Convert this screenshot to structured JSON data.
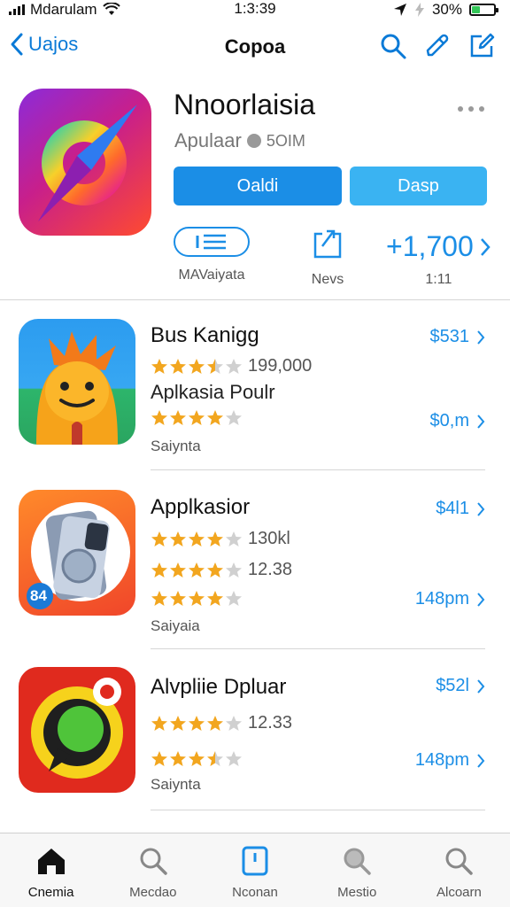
{
  "status": {
    "carrier": "Mdarulam",
    "time": "1:3:39",
    "battery": "30%"
  },
  "nav": {
    "back_label": "Uajos",
    "title": "Copoa"
  },
  "hero": {
    "name": "Nnoorlaisia",
    "subtitle": "Apulaar",
    "size": "5OIM",
    "primary_button": "Oaldi",
    "secondary_button": "Dasp",
    "stat1_label": "MAVaiyata",
    "stat2_label": "Nevs",
    "stat3_value": "+1,700",
    "stat3_label": "1:11"
  },
  "apps": [
    {
      "title": "Bus Kanigg",
      "price": "$531",
      "rating_count": "199,000",
      "subtitle": "Aplkasia Poulr",
      "price2": "$0,m",
      "category": "Saiynta"
    },
    {
      "title": "Applkasior",
      "price": "$4l1",
      "rating_count": "130kl",
      "rating_count2": "12.38",
      "price2": "148pm",
      "category": "Saiyaia",
      "badge": "84"
    },
    {
      "title": "Alvpliie Dpluar",
      "price": "$52l",
      "rating_count": "12.33",
      "price2": "148pm",
      "category": "Saiynta"
    }
  ],
  "tabs": [
    "Cnemia",
    "Mecdao",
    "Nconan",
    "Mestio",
    "Alcoarn"
  ],
  "icons": {
    "back": "chevron-left-icon",
    "search": "search-icon",
    "edit": "pencil-icon",
    "compose": "compose-icon",
    "more": "more-icon",
    "list": "list-icon",
    "share": "share-icon",
    "chevron": "chevron-right-icon"
  },
  "colors": {
    "accent": "#1b8ee6",
    "star": "#f2a61f",
    "battery": "#34c759"
  }
}
